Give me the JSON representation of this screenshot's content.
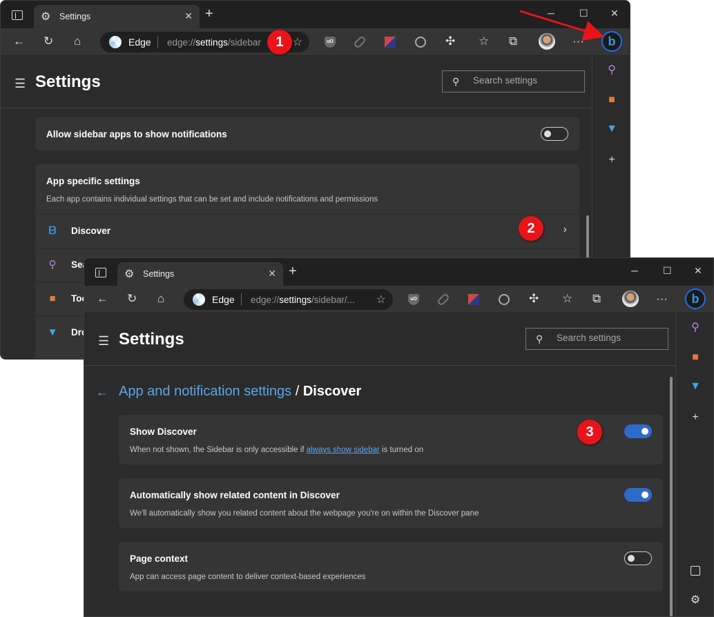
{
  "window1": {
    "tab_title": "Settings",
    "address": {
      "brand": "Edge",
      "url_prefix": "edge://",
      "url_bold": "settings",
      "url_rest": "/sidebar"
    },
    "page_title": "Settings",
    "search_placeholder": "Search settings",
    "notif_card": {
      "title": "Allow sidebar apps to show notifications",
      "toggle": "off"
    },
    "app_card": {
      "title": "App specific settings",
      "description": "Each app contains individual settings that can be set and include notifications and permissions",
      "rows": [
        {
          "label": "Discover",
          "icon": "bing-icon"
        },
        {
          "label": "Sea",
          "icon": "search-icon"
        },
        {
          "label": "Too",
          "icon": "tools-icon"
        },
        {
          "label": "Dro",
          "icon": "drop-icon"
        }
      ]
    }
  },
  "window2": {
    "tab_title": "Settings",
    "address": {
      "brand": "Edge",
      "url_prefix": "edge://",
      "url_bold": "settings",
      "url_rest": "/sidebar/..."
    },
    "page_title": "Settings",
    "search_placeholder": "Search settings",
    "breadcrumb": {
      "parent": "App and notification settings",
      "separator": " / ",
      "current": "Discover"
    },
    "cards": [
      {
        "title": "Show Discover",
        "desc_before": "When not shown, the Sidebar is only accessible if ",
        "desc_link": "always show sidebar",
        "desc_after": " is turned on",
        "toggle": "on"
      },
      {
        "title": "Automatically show related content in Discover",
        "desc": "We'll automatically show you related content about the webpage you're on within the Discover pane",
        "toggle": "on"
      },
      {
        "title": "Page context",
        "desc": "App can access page content to deliver context-based experiences",
        "toggle": "off"
      }
    ]
  },
  "annotations": {
    "badge1": "1",
    "badge2": "2",
    "badge3": "3",
    "arrow_color": "#e8141a"
  },
  "colors": {
    "accent": "#5aa6e8",
    "toggle_on": "#2f6ac9",
    "badge": "#e8141a"
  }
}
